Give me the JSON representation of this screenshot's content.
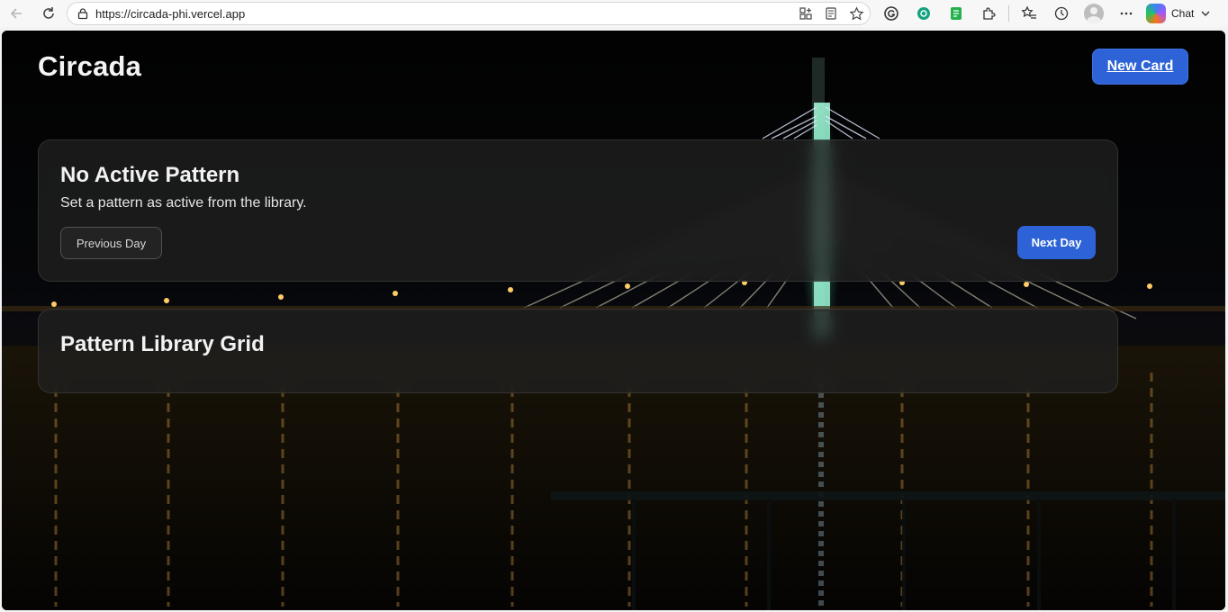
{
  "browser": {
    "url": "https://circada-phi.vercel.app",
    "chat_label": "Chat"
  },
  "app": {
    "brand": "Circada",
    "new_card_label": "New Card"
  },
  "active_pattern": {
    "title": "No Active Pattern",
    "subtitle": "Set a pattern as active from the library.",
    "prev_label": "Previous Day",
    "next_label": "Next Day"
  },
  "library": {
    "title": "Pattern Library Grid"
  },
  "colors": {
    "accent": "#2d63d6"
  }
}
